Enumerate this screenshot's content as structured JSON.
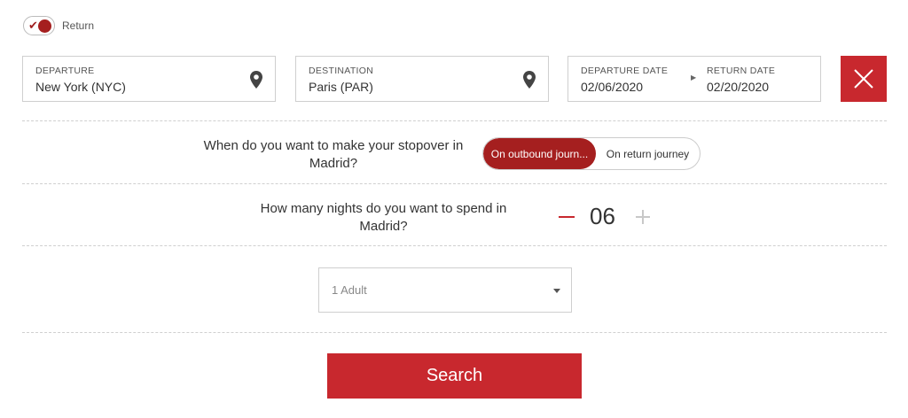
{
  "trip_toggle": {
    "label": "Return",
    "state": "on"
  },
  "departure": {
    "label": "DEPARTURE",
    "value": "New York (NYC)",
    "icon": "location-pin-icon"
  },
  "destination": {
    "label": "DESTINATION",
    "value": "Paris (PAR)",
    "icon": "location-pin-icon"
  },
  "dates": {
    "departure_label": "DEPARTURE DATE",
    "departure_value": "02/06/2020",
    "return_label": "RETURN DATE",
    "return_value": "02/20/2020"
  },
  "stopover": {
    "question_line1": "When do you want to make your stopover in",
    "question_line2": "Madrid?",
    "options": [
      "On outbound journ...",
      "On return journey"
    ],
    "selected": "On outbound journ..."
  },
  "nights": {
    "question_line1": "How many nights do you want to spend in",
    "question_line2": "Madrid?",
    "value": "06"
  },
  "passengers": {
    "selected": "1 Adult"
  },
  "search_label": "Search",
  "colors": {
    "accent": "#c8282e",
    "accent_dark": "#a51f1f",
    "border": "#cfcfcf"
  }
}
